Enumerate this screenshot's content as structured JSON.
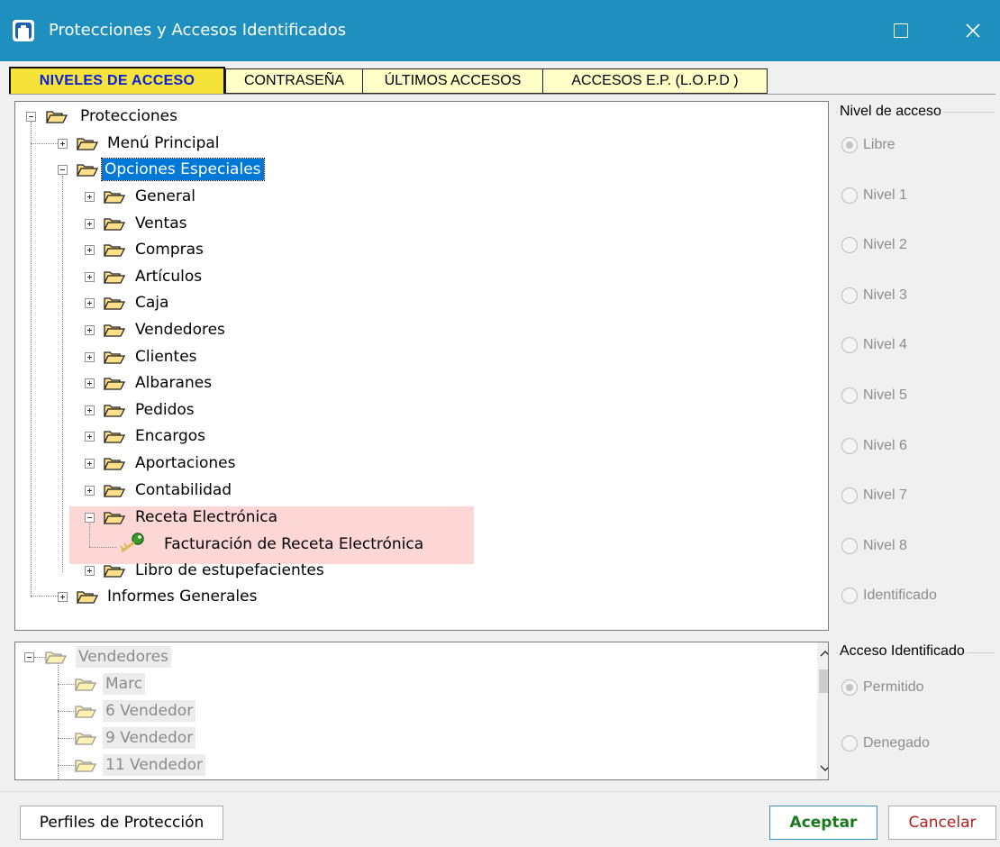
{
  "window": {
    "title": "Protecciones y Accesos Identificados"
  },
  "tabs": [
    {
      "label": "NIVELES DE ACCESO",
      "active": true
    },
    {
      "label": "CONTRASEÑA",
      "active": false
    },
    {
      "label": "ÚLTIMOS ACCESOS",
      "active": false
    },
    {
      "label": "ACCESOS E.P. (L.O.P.D )",
      "active": false
    }
  ],
  "tree": {
    "root": "Protecciones",
    "menu_principal": "Menú Principal",
    "opciones_especiales": "Opciones Especiales",
    "children": [
      "General",
      "Ventas",
      "Compras",
      "Artículos",
      "Caja",
      "Vendedores",
      "Clientes",
      "Albaranes",
      "Pedidos",
      "Encargos",
      "Aportaciones",
      "Contabilidad"
    ],
    "receta": "Receta Electrónica",
    "receta_child": "Facturación de Receta Electrónica",
    "libro": "Libro de estupefacientes",
    "informes": "Informes Generales"
  },
  "users_tree": {
    "root": "Vendedores",
    "items": [
      "Marc",
      "6 Vendedor",
      "9 Vendedor",
      "11 Vendedor"
    ]
  },
  "nivel_acceso": {
    "title": "Nivel de acceso",
    "options": [
      "Libre",
      "Nivel 1",
      "Nivel 2",
      "Nivel 3",
      "Nivel 4",
      "Nivel 5",
      "Nivel 6",
      "Nivel 7",
      "Nivel 8",
      "Identificado"
    ],
    "selected": "Libre"
  },
  "acceso_identificado": {
    "title": "Acceso Identificado",
    "options": [
      "Permitido",
      "Denegado"
    ],
    "selected": "Permitido"
  },
  "buttons": {
    "perfiles": "Perfiles de Protección",
    "aceptar": "Aceptar",
    "cancelar": "Cancelar"
  },
  "colors": {
    "titlebar": "#1e8fbe",
    "tab_active": "#f5e33a",
    "tab_inactive": "#ffffc8",
    "highlight": "#fcd7d6",
    "selection": "#0078d7"
  }
}
